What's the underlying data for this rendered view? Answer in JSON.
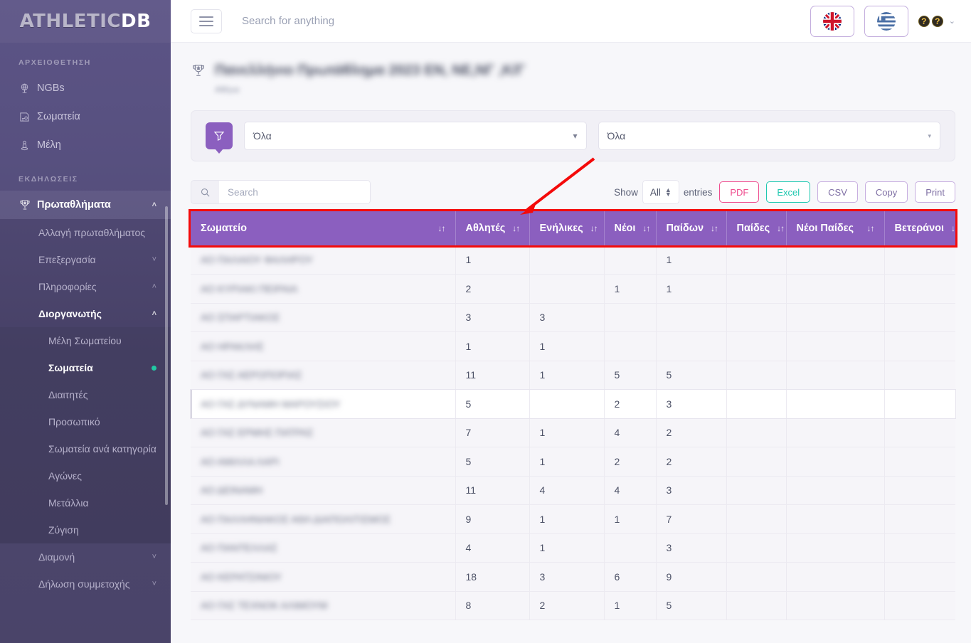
{
  "brand": {
    "part1": "ATHLETIC",
    "part2": "DB"
  },
  "topbar": {
    "search_placeholder": "Search for anything",
    "menu_icon": "hamburger-icon",
    "lang_en": "flag-uk-icon",
    "lang_gr": "flag-greece-icon",
    "user_caret": "⌄"
  },
  "sidebar": {
    "sections": [
      {
        "label": "ΑΡΧΕΙΟΘΕΤΗΣΗ"
      },
      {
        "label": "ΕΚΔΗΛΩΣΕΙΣ"
      }
    ],
    "archive_items": [
      {
        "label": "NGBs",
        "icon": "globe-icon"
      },
      {
        "label": "Σωματεία",
        "icon": "card-icon"
      },
      {
        "label": "Μέλη",
        "icon": "person-icon"
      }
    ],
    "events_parent": {
      "label": "Πρωταθλήματα",
      "icon": "trophy-icon",
      "chevron": "˄"
    },
    "events_children": [
      {
        "label": "Αλλαγή πρωταθλήματος",
        "chevron": ""
      },
      {
        "label": "Επεξεργασία",
        "chevron": "˅"
      },
      {
        "label": "Πληροφορίες",
        "chevron": "˄"
      },
      {
        "label": "Διοργανωτής",
        "chevron": "˄",
        "active": true
      }
    ],
    "organizer_children": [
      {
        "label": "Μέλη Σωματείου"
      },
      {
        "label": "Σωματεία",
        "active": true,
        "badge": "dot"
      },
      {
        "label": "Διαιτητές"
      },
      {
        "label": "Προσωπικό"
      },
      {
        "label": "Σωματεία ανά κατηγορία"
      },
      {
        "label": "Αγώνες"
      },
      {
        "label": "Μετάλλια"
      },
      {
        "label": "Ζύγιση"
      }
    ],
    "tail_items": [
      {
        "label": "Διαμονή",
        "chevron": "˅"
      },
      {
        "label": "Δήλωση συμμετοχής",
        "chevron": "˅"
      }
    ]
  },
  "page": {
    "title": "Πανελλήνιο Πρωτάθλημα 2023 ΕΝ, ΝΕ,ΝΓ ,Κ/Γ",
    "subtitle": "Αθήνα",
    "trophy_icon": "trophy-icon"
  },
  "filters": {
    "filter_icon": "funnel-icon",
    "select1_value": "Όλα",
    "select2_value": "Όλα"
  },
  "toolbar": {
    "search_placeholder": "Search",
    "search_icon": "search-icon",
    "show_label": "Show",
    "entries_label": "entries",
    "page_size": "All",
    "buttons": [
      {
        "label": "PDF",
        "style": "pdf"
      },
      {
        "label": "Excel",
        "style": "excel"
      },
      {
        "label": "CSV",
        "style": "plain"
      },
      {
        "label": "Copy",
        "style": "plain"
      },
      {
        "label": "Print",
        "style": "plain"
      }
    ]
  },
  "table": {
    "columns": [
      {
        "label": "Σωματείο",
        "sortable": true
      },
      {
        "label": "Αθλητές",
        "sortable": true
      },
      {
        "label": "Ενήλικες",
        "sortable": true
      },
      {
        "label": "Νέοι",
        "sortable": true
      },
      {
        "label": "Παίδων",
        "sortable": true
      },
      {
        "label": "Παίδες",
        "sortable": true
      },
      {
        "label": "Νέοι Παίδες",
        "sortable": true
      },
      {
        "label": "Βετεράνοι",
        "sortable": true
      }
    ],
    "sort_icon": "sort-updown-icon",
    "rows": [
      {
        "club": "ΑΟ ΠΑΛΑΙΟΥ ΦΑΛΗΡΟΥ",
        "athletes": "1",
        "adults": "",
        "youth": "",
        "juniors": "1",
        "boys": "",
        "young_boys": "",
        "veterans": ""
      },
      {
        "club": "ΑΟ ΚΥΡΙΑΚΙ ΠΕΙΡΑΙΑ",
        "athletes": "2",
        "adults": "",
        "youth": "1",
        "juniors": "1",
        "boys": "",
        "young_boys": "",
        "veterans": ""
      },
      {
        "club": "ΑΟ ΣΠΑΡΤΙΑΚΟΣ",
        "athletes": "3",
        "adults": "3",
        "youth": "",
        "juniors": "",
        "boys": "",
        "young_boys": "",
        "veterans": ""
      },
      {
        "club": "ΑΟ ΗΡΑΚΛΗΣ",
        "athletes": "1",
        "adults": "1",
        "youth": "",
        "juniors": "",
        "boys": "",
        "young_boys": "",
        "veterans": ""
      },
      {
        "club": "ΑΟ ΓΑΣ ΑΕΡΟΠΟΡΙΑΣ",
        "athletes": "11",
        "adults": "1",
        "youth": "5",
        "juniors": "5",
        "boys": "",
        "young_boys": "",
        "veterans": ""
      },
      {
        "club": "ΑΟ ΓΑΣ ΔΥΝΑΜΗ ΜΑΡΟΥΣΙΟΥ",
        "athletes": "5",
        "adults": "",
        "youth": "2",
        "juniors": "3",
        "boys": "",
        "young_boys": "",
        "veterans": "",
        "highlight": true
      },
      {
        "club": "ΑΟ ΓΑΣ ΕΡΜΗΣ ΠΑΤΡΑΣ",
        "athletes": "7",
        "adults": "1",
        "youth": "4",
        "juniors": "2",
        "boys": "",
        "young_boys": "",
        "veterans": ""
      },
      {
        "club": "ΑΟ ΑΜΙΛΛΑ ΛΑΡΙ",
        "athletes": "5",
        "adults": "1",
        "youth": "2",
        "juniors": "2",
        "boys": "",
        "young_boys": "",
        "veterans": ""
      },
      {
        "club": "ΑΟ ΔΕΙΝΑΜΗ",
        "athletes": "11",
        "adults": "4",
        "youth": "4",
        "juniors": "3",
        "boys": "",
        "young_boys": "",
        "veterans": ""
      },
      {
        "club": "ΑΟ ΠΑΛΛΗΝΙΑΚΟΣ ΑΘΛ ΔΙΑΠΟΛΙΤΙΣΜΟΣ",
        "athletes": "9",
        "adults": "1",
        "youth": "1",
        "juniors": "7",
        "boys": "",
        "young_boys": "",
        "veterans": ""
      },
      {
        "club": "ΑΟ ΠΑΝΤΕΛΛΑΣ",
        "athletes": "4",
        "adults": "1",
        "youth": "",
        "juniors": "3",
        "boys": "",
        "young_boys": "",
        "veterans": ""
      },
      {
        "club": "ΑΟ ΚΕΡΑΤΣΙΝΙΟΥ",
        "athletes": "18",
        "adults": "3",
        "youth": "6",
        "juniors": "9",
        "boys": "",
        "young_boys": "",
        "veterans": ""
      },
      {
        "club": "ΑΟ ΓΑΣ ΤΕΧΝΟΚ ΑΛΙΜΟΥΜ",
        "athletes": "8",
        "adults": "2",
        "youth": "1",
        "juniors": "5",
        "boys": "",
        "young_boys": "",
        "veterans": ""
      }
    ]
  },
  "annotations": {
    "header_highlight_color": "#f40a0a",
    "arrow_color": "#f40a0a"
  },
  "colors": {
    "sidebar": "#544d7d",
    "table_header": "#8b5fbf",
    "accent": "#8b5fbf",
    "pdf": "#ef4d8e",
    "excel": "#1fc8b0"
  }
}
